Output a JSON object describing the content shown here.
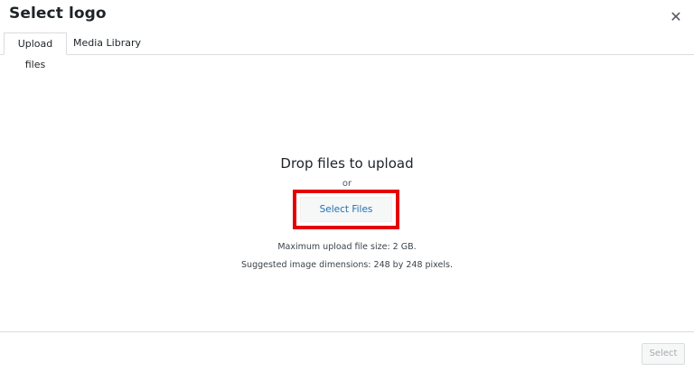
{
  "header": {
    "title": "Select logo",
    "close_glyph": "✕"
  },
  "tabs": [
    {
      "label": "Upload files",
      "active": true
    },
    {
      "label": "Media Library",
      "active": false
    }
  ],
  "uploader": {
    "drop_text": "Drop files to upload",
    "or_text": "or",
    "select_files_label": "Select Files",
    "max_size_text": "Maximum upload file size: 2 GB.",
    "suggested_dims_text": "Suggested image dimensions: 248 by 248 pixels.",
    "highlight_color": "#e60000"
  },
  "footer": {
    "select_label": "Select",
    "select_disabled": true
  }
}
